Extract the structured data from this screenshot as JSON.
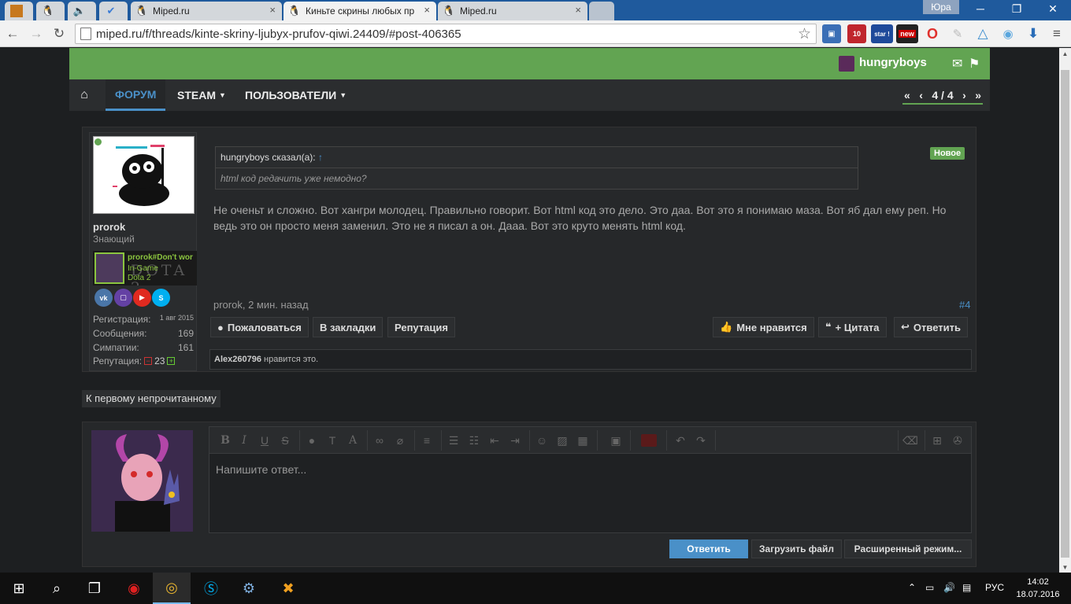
{
  "browser": {
    "tabs": [
      {
        "label": "",
        "icon": "game-icon"
      },
      {
        "label": "",
        "icon": "penguin-icon"
      },
      {
        "label": "",
        "icon": "mute-icon"
      },
      {
        "label": "",
        "icon": "check-icon"
      },
      {
        "label": "Miped.ru",
        "icon": "penguin-icon"
      },
      {
        "label": "Киньте скрины любых пр",
        "icon": "penguin-icon"
      },
      {
        "label": "Miped.ru",
        "icon": "penguin-icon"
      }
    ],
    "profile_name": "Юра",
    "url": "miped.ru/f/threads/kinte-skriny-ljubyx-prufov-qiwi.24409/#post-406365",
    "extensions": {
      "abp_count": "10",
      "star_label": "star !",
      "new_label": "new"
    }
  },
  "header": {
    "username": "hungryboys"
  },
  "nav": {
    "forum": "ФОРУМ",
    "steam": "STEAM",
    "users": "ПОЛЬЗОВАТЕЛИ",
    "pager": "4 / 4"
  },
  "post": {
    "author": "prorok",
    "author_title": "Знающий",
    "steam": {
      "name": "prorok#Don't wor",
      "status": "In-Game",
      "game": "Dota 2",
      "banner": "DOTA 2"
    },
    "stats": [
      {
        "label": "Регистрация:",
        "value": "1 авг 2015"
      },
      {
        "label": "Сообщения:",
        "value": "169"
      },
      {
        "label": "Симпатии:",
        "value": "161"
      }
    ],
    "reputation_label": "Репутация:",
    "reputation_value": "23",
    "quote_author": "hungryboys сказал(а):",
    "quote_arrow": "↑",
    "quote_text": "html код редачить уже немодно?",
    "badge": "Новое",
    "message": "Не оченьт и сложно. Вот хангри молодец. Правильно говорит. Вот html код это дело. Это даа. Вот это я понимаю маза. Вот яб дал ему реп. Но ведь это он просто меня заменил. Это не я писал а он. Дааа. Вот это круто менять html код.",
    "meta": "prorok, 2 мин. назад",
    "number": "#4",
    "actions": {
      "report": "Пожаловаться",
      "bookmark": "В закладки",
      "reputation": "Репутация",
      "like": "Мне нравится",
      "quote": "+ Цитата",
      "reply": "Ответить"
    },
    "likes_user": "Alex260796",
    "likes_text": " нравится это."
  },
  "first_unread": "К первому непрочитанному",
  "reply": {
    "placeholder": "Напишите ответ...",
    "submit": "Ответить",
    "upload": "Загрузить файл",
    "advanced": "Расширенный режим..."
  },
  "taskbar": {
    "lang": "РУС",
    "time": "14:02",
    "date": "18.07.2016"
  }
}
